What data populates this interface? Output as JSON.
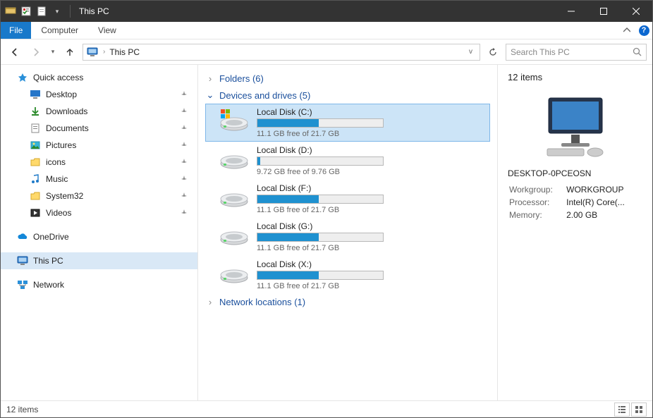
{
  "window": {
    "title": "This PC"
  },
  "ribbon": {
    "file": "File",
    "tabs": [
      "Computer",
      "View"
    ]
  },
  "address": {
    "path": "This PC"
  },
  "search": {
    "placeholder": "Search This PC"
  },
  "sidebar": {
    "quick_access": "Quick access",
    "pinned": [
      {
        "label": "Desktop",
        "icon": "desktop"
      },
      {
        "label": "Downloads",
        "icon": "downloads"
      },
      {
        "label": "Documents",
        "icon": "documents"
      },
      {
        "label": "Pictures",
        "icon": "pictures"
      },
      {
        "label": "icons",
        "icon": "folder"
      },
      {
        "label": "Music",
        "icon": "music"
      },
      {
        "label": "System32",
        "icon": "folder"
      },
      {
        "label": "Videos",
        "icon": "videos"
      }
    ],
    "onedrive": "OneDrive",
    "this_pc": "This PC",
    "network": "Network"
  },
  "groups": {
    "folders": {
      "label": "Folders (6)"
    },
    "devices": {
      "label": "Devices and drives (5)"
    },
    "network": {
      "label": "Network locations (1)"
    }
  },
  "drives": [
    {
      "name": "Local Disk (C:)",
      "free": "11.1 GB free of 21.7 GB",
      "fill_pct": 49,
      "os": true,
      "selected": true
    },
    {
      "name": "Local Disk (D:)",
      "free": "9.72 GB free of 9.76 GB",
      "fill_pct": 2,
      "os": false,
      "selected": false
    },
    {
      "name": "Local Disk (F:)",
      "free": "11.1 GB free of 21.7 GB",
      "fill_pct": 49,
      "os": false,
      "selected": false
    },
    {
      "name": "Local Disk (G:)",
      "free": "11.1 GB free of 21.7 GB",
      "fill_pct": 49,
      "os": false,
      "selected": false
    },
    {
      "name": "Local Disk (X:)",
      "free": "11.1 GB free of 21.7 GB",
      "fill_pct": 49,
      "os": false,
      "selected": false
    }
  ],
  "details": {
    "count": "12 items",
    "pc_name": "DESKTOP-0PCEOSN",
    "rows": [
      {
        "k": "Workgroup:",
        "v": "WORKGROUP"
      },
      {
        "k": "Processor:",
        "v": "Intel(R) Core(..."
      },
      {
        "k": "Memory:",
        "v": "2.00 GB"
      }
    ]
  },
  "status": {
    "text": "12 items"
  }
}
